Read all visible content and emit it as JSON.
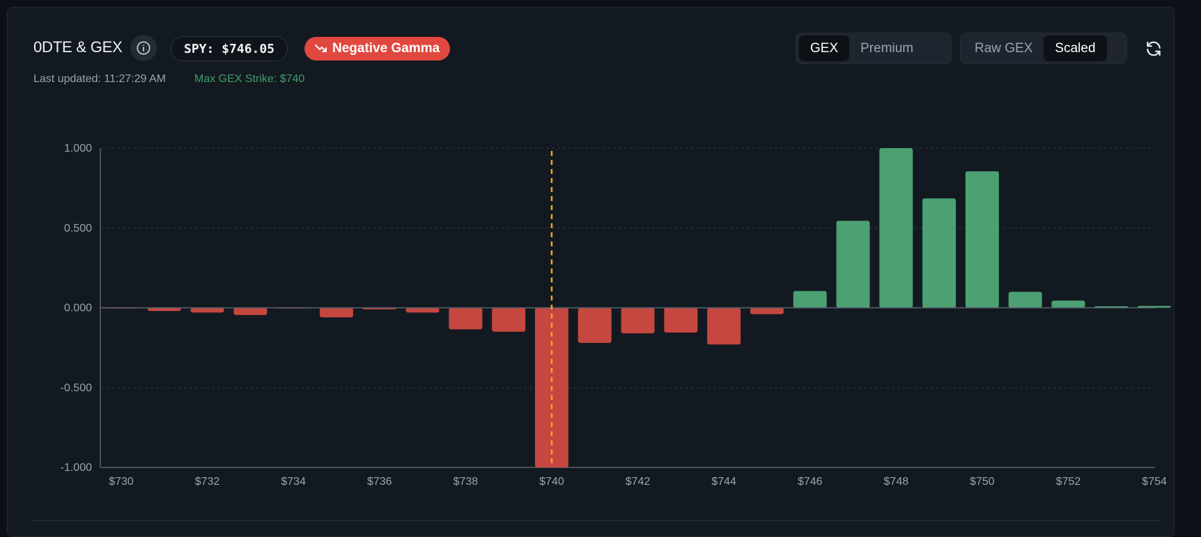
{
  "header": {
    "title": "0DTE & GEX",
    "price": "SPY: $746.05",
    "gamma_badge": "Negative Gamma",
    "last_updated": "Last updated: 11:27:29 AM",
    "max_strike": "Max GEX Strike: $740"
  },
  "toggles": {
    "mode": {
      "options": [
        "GEX",
        "Premium"
      ],
      "selected": "GEX"
    },
    "scale": {
      "options": [
        "Raw GEX",
        "Scaled"
      ],
      "selected": "Scaled"
    }
  },
  "icons": {
    "info": "info-icon",
    "refresh": "refresh-icon",
    "trend": "trending-down-icon"
  },
  "colors": {
    "negative": "#c5473f",
    "positive": "#4ca072",
    "marker": "#f5a623",
    "badge": "#e0483f"
  },
  "chart_data": {
    "type": "bar",
    "categories": [
      "$730",
      "$731",
      "$732",
      "$733",
      "$734",
      "$735",
      "$736",
      "$737",
      "$738",
      "$739",
      "$740",
      "$741",
      "$742",
      "$743",
      "$744",
      "$745",
      "$746",
      "$747",
      "$748",
      "$749",
      "$750",
      "$751",
      "$752",
      "$753",
      "$754"
    ],
    "x_tick_labels": [
      "$730",
      "$732",
      "$734",
      "$736",
      "$738",
      "$740",
      "$742",
      "$744",
      "$746",
      "$748",
      "$750",
      "$752",
      "$754"
    ],
    "values": [
      -0.004,
      -0.02,
      -0.03,
      -0.045,
      -0.003,
      -0.06,
      -0.01,
      -0.03,
      -0.135,
      -0.15,
      -1.0,
      -0.22,
      -0.16,
      -0.155,
      -0.23,
      -0.04,
      0.105,
      0.545,
      1.0,
      0.685,
      0.855,
      0.1,
      0.045,
      0.01,
      0.012
    ],
    "ylim": [
      -1.0,
      1.0
    ],
    "y_ticks": [
      "1.000",
      "0.500",
      "0.000",
      "-0.500",
      "-1.000"
    ],
    "y_tick_values": [
      1.0,
      0.5,
      0.0,
      -0.5,
      -1.0
    ],
    "marker_strike": "$740",
    "grid": true
  }
}
